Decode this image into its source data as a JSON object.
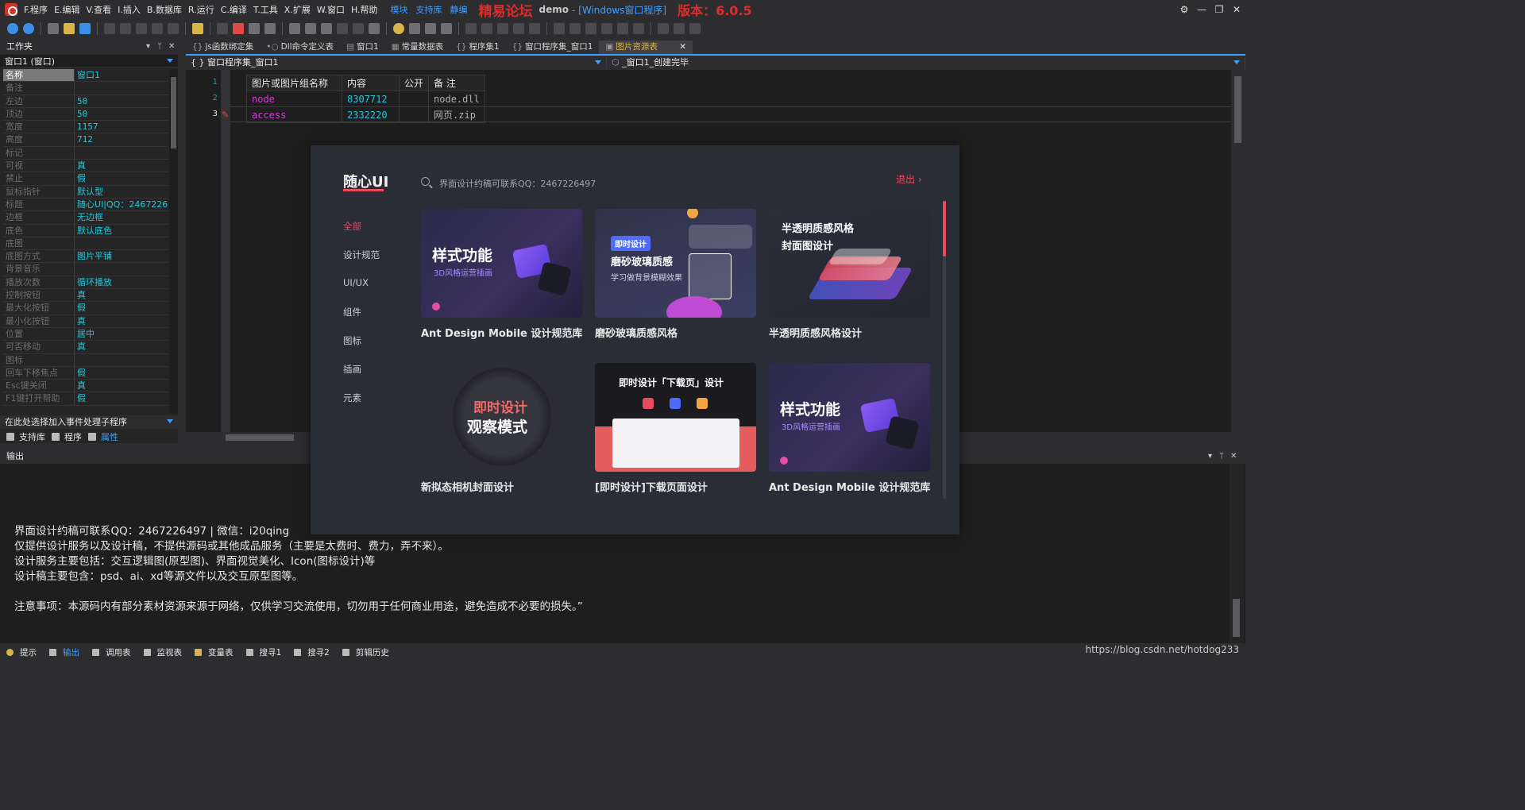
{
  "menu": {
    "items": [
      "F.程序",
      "E.编辑",
      "V.查看",
      "I.插入",
      "B.数据库",
      "R.运行",
      "C.编译",
      "T.工具",
      "X.扩展",
      "W.窗口",
      "H.帮助"
    ],
    "links": [
      "模块",
      "支持库",
      "静编"
    ],
    "forum_title": "精易论坛",
    "project": "demo",
    "project_type": "- [Windows窗口程序]",
    "version": "版本：6.0.5"
  },
  "workspace": {
    "title": "工作夹",
    "window_select": "窗口1 (窗口)",
    "properties": [
      {
        "name": "名称",
        "value": "窗口1",
        "state": "selected"
      },
      {
        "name": "备注",
        "value": "",
        "state": "off"
      },
      {
        "name": "左边",
        "value": "50",
        "state": "off"
      },
      {
        "name": "顶边",
        "value": "50",
        "state": "off"
      },
      {
        "name": "宽度",
        "value": "1157",
        "state": "off"
      },
      {
        "name": "高度",
        "value": "712",
        "state": "off"
      },
      {
        "name": "标记",
        "value": "",
        "state": "off"
      },
      {
        "name": "可视",
        "value": "真",
        "state": "off"
      },
      {
        "name": "禁止",
        "value": "假",
        "state": "off"
      },
      {
        "name": "鼠标指针",
        "value": "默认型",
        "state": "off"
      },
      {
        "name": "标题",
        "value": "随心UI|QQ：2467226",
        "state": "off"
      },
      {
        "name": "边框",
        "value": "无边框",
        "state": "off"
      },
      {
        "name": "底色",
        "value": "默认底色",
        "state": "off"
      },
      {
        "name": "底图",
        "value": "",
        "state": "off"
      },
      {
        "name": "  底图方式",
        "value": "图片平铺",
        "state": "off"
      },
      {
        "name": "背景音乐",
        "value": "",
        "state": "off"
      },
      {
        "name": "  播放次数",
        "value": "循环播放",
        "state": "off"
      },
      {
        "name": "控制按钮",
        "value": "真",
        "state": "off"
      },
      {
        "name": "  最大化按钮",
        "value": "假",
        "state": "off"
      },
      {
        "name": "  最小化按钮",
        "value": "真",
        "state": "off"
      },
      {
        "name": "位置",
        "value": "居中",
        "state": "off"
      },
      {
        "name": "可否移动",
        "value": "真",
        "state": "off"
      },
      {
        "name": "图标",
        "value": "",
        "state": "off"
      },
      {
        "name": "回车下移焦点",
        "value": "假",
        "state": "off"
      },
      {
        "name": "Esc键关闭",
        "value": "真",
        "state": "off"
      },
      {
        "name": "F1键打开帮助",
        "value": "假",
        "state": "off"
      }
    ],
    "event_select": "在此处选择加入事件处理子程序",
    "tabs": [
      "支持库",
      "程序",
      "属性"
    ]
  },
  "editor": {
    "tabs": [
      {
        "icon": "{}",
        "label": "js函数绑定集"
      },
      {
        "icon": "•○",
        "label": "Dll命令定义表"
      },
      {
        "icon": "▤",
        "label": "窗口1"
      },
      {
        "icon": "▦",
        "label": "常量数据表"
      },
      {
        "icon": "{}",
        "label": "程序集1"
      },
      {
        "icon": "{}",
        "label": "窗口程序集_窗口1"
      },
      {
        "icon": "▣",
        "label": "图片资源表",
        "active": true
      }
    ],
    "context_left": "{ } 窗口程序集_窗口1",
    "context_right": "_窗口1_创建完毕",
    "line_numbers": [
      "1",
      "2",
      "3"
    ],
    "table_headers": [
      "图片或图片组名称",
      "内容",
      "公开",
      "备 注"
    ],
    "rows": [
      {
        "name": "node",
        "value": "8307712",
        "public": "",
        "note": "node.dll"
      },
      {
        "name": "access",
        "value": "2332220",
        "public": "",
        "note": "网页.zip"
      }
    ]
  },
  "preview": {
    "logo": "随心UI",
    "search_placeholder": "界面设计约稿可联系QQ：2467226497",
    "exit": "退出 ›",
    "categories": [
      "全部",
      "设计规范",
      "UI/UX",
      "组件",
      "图标",
      "插画",
      "元素"
    ],
    "cards": [
      {
        "title": "Ant Design Mobile 设计规范库",
        "heading": "样式功能",
        "sub": "3D风格运营插画"
      },
      {
        "title": "磨砂玻璃质感风格",
        "heading": "磨砂玻璃质感",
        "sub": "学习做背景模糊效果",
        "badge": "即时设计"
      },
      {
        "title": "半透明质感风格设计",
        "heading": "半透明质感风格",
        "sub": "封面图设计"
      },
      {
        "title": "新拟态相机封面设计",
        "heading": "即时设计",
        "sub": "观察模式"
      },
      {
        "title": "[即时设计]下载页面设计",
        "heading": "即时设计「下载页」设计",
        "sub": ""
      },
      {
        "title": "Ant Design Mobile 设计规范库",
        "heading": "样式功能",
        "sub": "3D风格运营插画"
      }
    ]
  },
  "output": {
    "title": "输出",
    "lines": [
      "界面设计约稿可联系QQ：2467226497 | 微信：i20qing",
      "仅提供设计服务以及设计稿，不提供源码或其他成品服务（主要是太费时、费力，弄不来）。",
      "设计服务主要包括：交互逻辑图(原型图)、界面视觉美化、Icon(图标设计)等",
      "设计稿主要包含：psd、ai、xd等源文件以及交互原型图等。",
      "",
      "注意事项：本源码内有部分素材资源来源于网络，仅供学习交流使用，切勿用于任何商业用途，避免造成不必要的损失。”"
    ]
  },
  "bottom_tabs": [
    "提示",
    "输出",
    "调用表",
    "监视表",
    "变量表",
    "搜寻1",
    "搜寻2",
    "剪辑历史"
  ],
  "watermark": "https://blog.csdn.net/hotdog233",
  "colors": {
    "accent": "#3ea0ff",
    "brand_red": "#e84b5c",
    "value_cyan": "#26c6da",
    "name_magenta": "#d63bd6"
  }
}
